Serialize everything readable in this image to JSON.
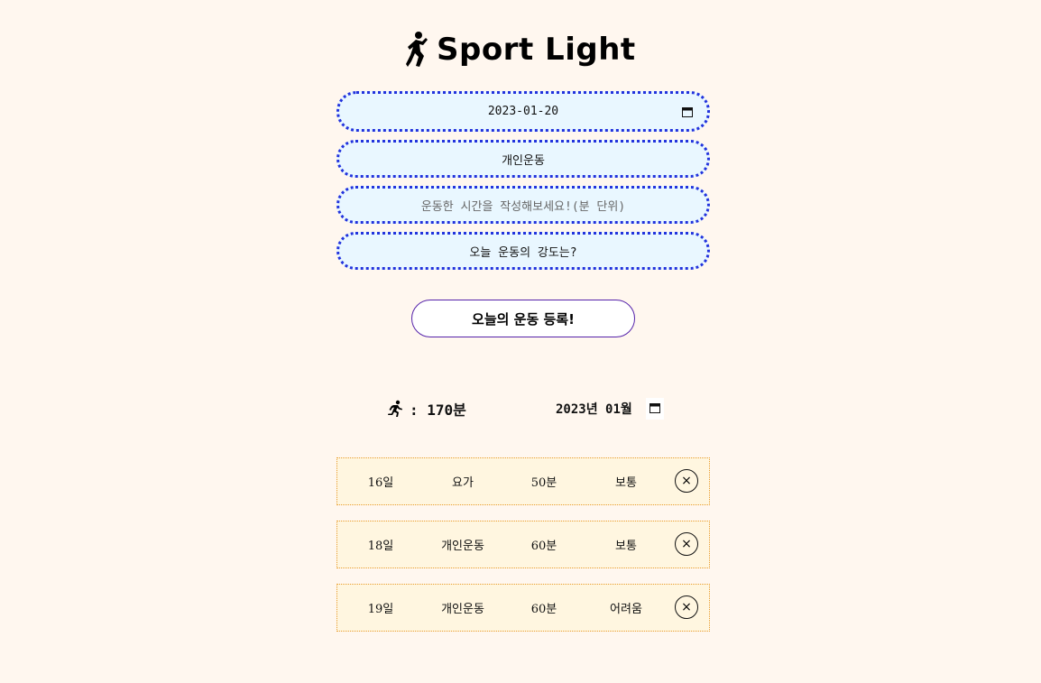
{
  "header": {
    "logo_text": "Sport Light",
    "logo_icon": "person-sport-icon"
  },
  "form": {
    "date_value": "2023-01-20",
    "category_value": "개인운동",
    "duration_placeholder": "운동한 시간을 작성해보세요!(분 단위)",
    "intensity_value": "오늘 운동의 강도는?",
    "submit_label": "오늘의 운동 등록!"
  },
  "summary": {
    "icon": "running-person-icon",
    "total_text": ": 170분",
    "month_value": "2023년 01월"
  },
  "records": [
    {
      "day": "16일",
      "type": "요가",
      "duration": "50분",
      "intensity": "보통",
      "delete_label": "×"
    },
    {
      "day": "18일",
      "type": "개인운동",
      "duration": "60분",
      "intensity": "보통",
      "delete_label": "×"
    },
    {
      "day": "19일",
      "type": "개인운동",
      "duration": "60분",
      "intensity": "어려움",
      "delete_label": "×"
    }
  ],
  "colors": {
    "page_bg": "#fff7ef",
    "field_bg": "#e9f7ff",
    "field_border": "#2233dd",
    "record_bg": "#fff6e0",
    "record_border": "#e89b2a",
    "button_border": "#5522aa"
  }
}
